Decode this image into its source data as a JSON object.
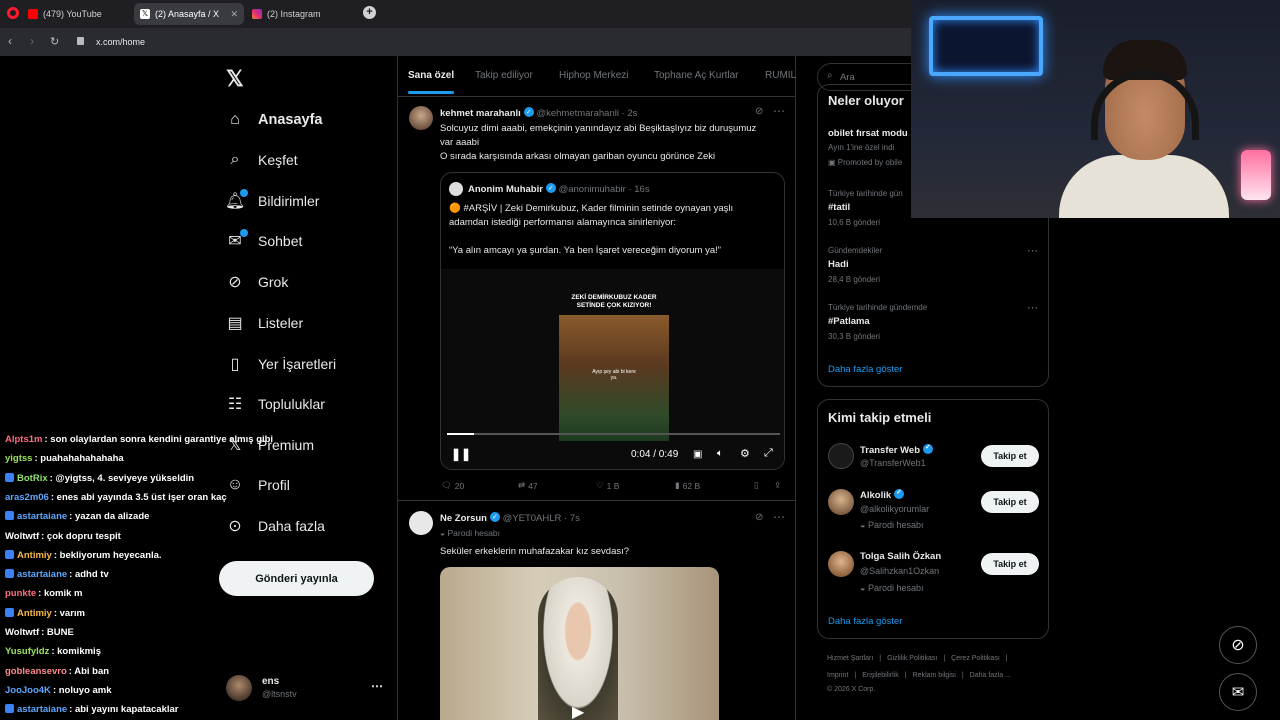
{
  "browser": {
    "tabs": [
      {
        "label": "(479) YouTube",
        "color": "#ff0000"
      },
      {
        "label": "(2) Anasayfa / X",
        "color": "#ffffff"
      },
      {
        "label": "(2) Instagram",
        "color": "#e1306c"
      }
    ],
    "url": "x.com/home"
  },
  "nav": {
    "items": [
      {
        "label": "Anasayfa",
        "icon": "home-icon"
      },
      {
        "label": "Keşfet",
        "icon": "search-icon"
      },
      {
        "label": "Bildirimler",
        "icon": "bell-icon"
      },
      {
        "label": "Sohbet",
        "icon": "mail-icon"
      },
      {
        "label": "Grok",
        "icon": "grok-icon"
      },
      {
        "label": "Listeler",
        "icon": "list-icon"
      },
      {
        "label": "Yer İşaretleri",
        "icon": "bookmark-icon"
      },
      {
        "label": "Topluluklar",
        "icon": "people-icon"
      },
      {
        "label": "Premium",
        "icon": "x-icon"
      },
      {
        "label": "Profil",
        "icon": "user-icon"
      },
      {
        "label": "Daha fazla",
        "icon": "more-circle-icon"
      }
    ],
    "post_button": "Gönderi yayınla",
    "account": {
      "name": "ens",
      "handle": "@ltsnstv"
    }
  },
  "timeline": {
    "tabs": [
      "Sana özel",
      "Takip ediliyor",
      "Hiphop Merkezi",
      "Tophane Aç Kurtlar",
      "RUMIL"
    ],
    "tweet1": {
      "name": "kehmet marahanlı",
      "handle": "@kehmetmarahanli",
      "time": "· 2s",
      "text1": "Solcuyuz dimi aaabi, emekçinin yanındayız abi Beşiktaşlıyız biz duruşumuz",
      "text2": "var aaabi",
      "text3": "O sırada karşısında arkası olmayan gariban oyuncu görünce Zeki",
      "quote": {
        "name": "Anonim Muhabir",
        "handle": "@anonimuhabir",
        "time": "· 16s",
        "text1": "🟠 #ARŞİV | Zeki Demirkubuz, Kader filminin setinde oynayan yaşlı",
        "text2": "adamdan istediği performansı alamayınca sinirleniyor:",
        "text3": "“Ya alın amcayı ya şurdan. Ya ben İşaret vereceğim diyorum ya!”",
        "video_caption1": "ZEKİ DEMİRKUBUZ KADER",
        "video_caption2": "SETİNDE ÇOK KIZIYOR!",
        "video_sub": "Ayıp şey abi bi kere ya.",
        "time_display": "0:04 / 0:49",
        "progress": 0.08
      },
      "stats": {
        "replies": "20",
        "retweets": "47",
        "likes": "1 B",
        "views": "62 B"
      }
    },
    "tweet2": {
      "name": "Ne Zorsun",
      "handle": "@YET0AHLR",
      "time": "· 7s",
      "label": "Parodi hesabı",
      "text": "Seküler erkeklerin muhafazakar kız sevdası?"
    }
  },
  "right": {
    "search_placeholder": "Ara",
    "trends_title": "Neler oluyor",
    "trends": [
      {
        "context": "",
        "title": "obilet fırsat modu",
        "sub": "Ayın 1'ine özel indi",
        "extra": "Promoted by obile"
      },
      {
        "context": "Türkiye tarihinde gün",
        "title": "#tatil",
        "sub": "10,6 B gönderi"
      },
      {
        "context": "Gündemdekiler",
        "title": "Hadi",
        "sub": "28,4 B gönderi"
      },
      {
        "context": "Türkiye tarihinde gündemde",
        "title": "#Patlama",
        "sub": "30,3 B gönderi"
      }
    ],
    "show_more": "Daha fazla göster",
    "who_title": "Kimi takip etmeli",
    "who": [
      {
        "name": "Transfer Web",
        "handle": "@TransferWeb1",
        "label": ""
      },
      {
        "name": "Alkolik",
        "handle": "@alkolikyorumlar",
        "label": "Parodi hesabı"
      },
      {
        "name": "Tolga Salih Özkan",
        "handle": "@Salihzkan1Ozkan",
        "label": "Parodi hesabı"
      }
    ],
    "follow_label": "Takip et",
    "show_more2": "Daha fazla göster",
    "footer1": [
      "Hizmet Şartları",
      "|",
      "Gizlilik Politikası",
      "|",
      "Çerez Politikası",
      "|"
    ],
    "footer2": [
      "Imprint",
      "|",
      "Erişilebilirlik",
      "|",
      "Reklam bilgisi",
      "|",
      "Daha fazla ..."
    ],
    "copyright": "© 2026 X Corp."
  },
  "chat": [
    {
      "user": "Alpts1m",
      "color": "#ff6b81",
      "msg": ": son olaylardan sonra kendini garantiye almış gibi",
      "badge": false
    },
    {
      "user": "yigtss",
      "color": "#9be15d",
      "msg": ": puahahahahahaha",
      "badge": false
    },
    {
      "user": "BotRix",
      "color": "#8fe36b",
      "msg": ": @yigtss, 4. seviyeye yükseldin",
      "badge": true
    },
    {
      "user": "aras2m06",
      "color": "#5ea6ff",
      "msg": ": enes abi yayında 3.5 üst işer oran kaç",
      "badge": false
    },
    {
      "user": "astartaiane",
      "color": "#5ea6ff",
      "msg": ": yazan da alizade",
      "badge": true
    },
    {
      "user": "Woltwtf",
      "color": "#ffffff",
      "msg": ": çok dopru tespit",
      "badge": false
    },
    {
      "user": "Antimiy",
      "color": "#f7b84b",
      "msg": ": bekliyorum heyecanla.",
      "badge": true
    },
    {
      "user": "astartaiane",
      "color": "#5ea6ff",
      "msg": ": adhd tv",
      "badge": true
    },
    {
      "user": "punkte",
      "color": "#ff6b81",
      "msg": ": komik m",
      "badge": false
    },
    {
      "user": "Antimiy",
      "color": "#f7b84b",
      "msg": ": varım",
      "badge": true
    },
    {
      "user": "Woltwtf",
      "color": "#ffffff",
      "msg": ": BUNE",
      "badge": false
    },
    {
      "user": "Yusufyldz",
      "color": "#9be15d",
      "msg": ": komikmiş",
      "badge": false
    },
    {
      "user": "gobleansevro",
      "color": "#ff8a8a",
      "msg": ": Abi ban",
      "badge": false
    },
    {
      "user": "JooJoo4K",
      "color": "#5ea6ff",
      "msg": ": noluyo amk",
      "badge": false
    },
    {
      "user": "astartaiane",
      "color": "#5ea6ff",
      "msg": ": abi yayını kapatacaklar",
      "badge": true
    }
  ]
}
